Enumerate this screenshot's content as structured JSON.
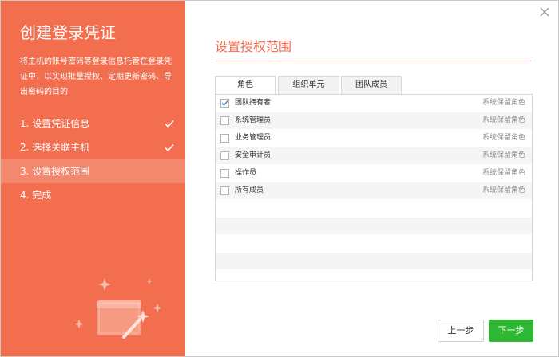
{
  "sidebar": {
    "title": "创建登录凭证",
    "description": "将主机的账号密码等登录信息托管在登录凭证中，以实现批量授权、定期更新密码、导出密码的目的",
    "steps": [
      {
        "label": "1. 设置凭证信息",
        "done": true
      },
      {
        "label": "2. 选择关联主机",
        "done": true
      },
      {
        "label": "3. 设置授权范围",
        "done": false
      },
      {
        "label": "4. 完成",
        "done": false
      }
    ],
    "active_step": 3
  },
  "main": {
    "title": "设置授权范围",
    "tabs": [
      {
        "label": "角色",
        "active": true
      },
      {
        "label": "组织单元",
        "active": false
      },
      {
        "label": "团队成员",
        "active": false
      }
    ],
    "rows": [
      {
        "name": "团队拥有者",
        "tag": "系统保留角色",
        "checked": true
      },
      {
        "name": "系统管理员",
        "tag": "系统保留角色",
        "checked": false
      },
      {
        "name": "业务管理员",
        "tag": "系统保留角色",
        "checked": false
      },
      {
        "name": "安全审计员",
        "tag": "系统保留角色",
        "checked": false
      },
      {
        "name": "操作员",
        "tag": "系统保留角色",
        "checked": false
      },
      {
        "name": "所有成员",
        "tag": "系统保留角色",
        "checked": false
      }
    ]
  },
  "footer": {
    "prev_label": "上一步",
    "next_label": "下一步"
  },
  "colors": {
    "accent": "#f26e4f",
    "primary_button": "#2fb831"
  }
}
